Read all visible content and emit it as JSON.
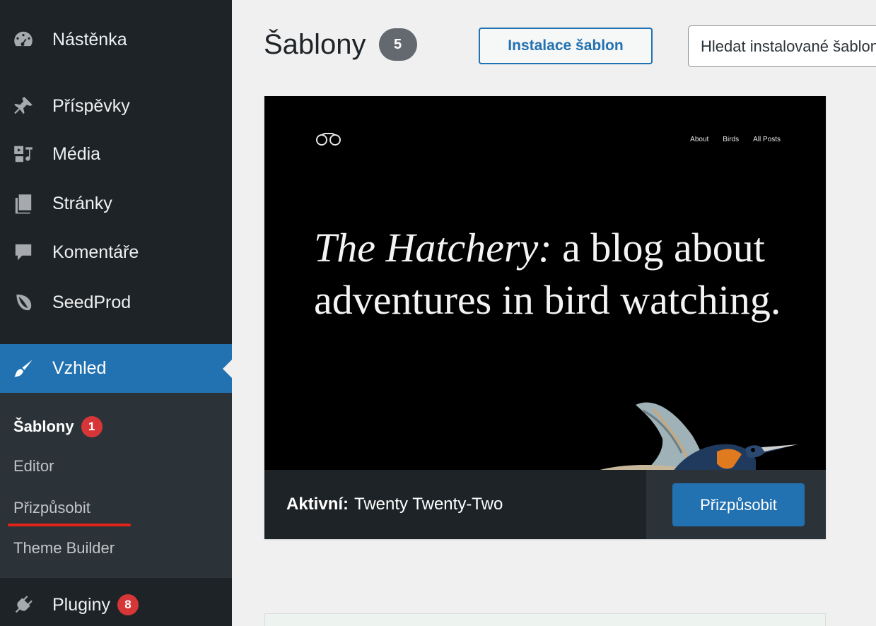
{
  "sidebar": {
    "items": [
      {
        "label": "Nástěnka",
        "icon": "dashboard-icon"
      },
      {
        "label": "Příspěvky",
        "icon": "pin-icon"
      },
      {
        "label": "Média",
        "icon": "media-icon"
      },
      {
        "label": "Stránky",
        "icon": "pages-icon"
      },
      {
        "label": "Komentáře",
        "icon": "comment-icon"
      },
      {
        "label": "SeedProd",
        "icon": "seedprod-leaf-icon"
      },
      {
        "label": "Vzhled",
        "icon": "paintbrush-icon",
        "active": true
      },
      {
        "label": "Pluginy",
        "icon": "plugin-icon",
        "count": "8"
      }
    ],
    "submenu": [
      {
        "label": "Šablony",
        "count": "1",
        "current": true
      },
      {
        "label": "Editor"
      },
      {
        "label": "Přizpůsobit"
      },
      {
        "label": "Theme Builder"
      }
    ]
  },
  "header": {
    "title": "Šablony",
    "count": "5",
    "add_new_label": "Instalace šablon",
    "search_placeholder": "Hledat instalované šablony..."
  },
  "theme": {
    "preview": {
      "nav": [
        "About",
        "Birds",
        "All Posts"
      ],
      "headline_italic": "The Hatchery:",
      "headline_rest": " a blog about adventures in bird watching."
    },
    "active_prefix": "Aktivní:",
    "name": "Twenty Twenty-Two",
    "customize_label": "Přizpůsobit"
  },
  "colors": {
    "sidebar_bg": "#1d2327",
    "accent": "#2271b1",
    "badge_red": "#d63638",
    "annotation_red": "#e2231a"
  }
}
